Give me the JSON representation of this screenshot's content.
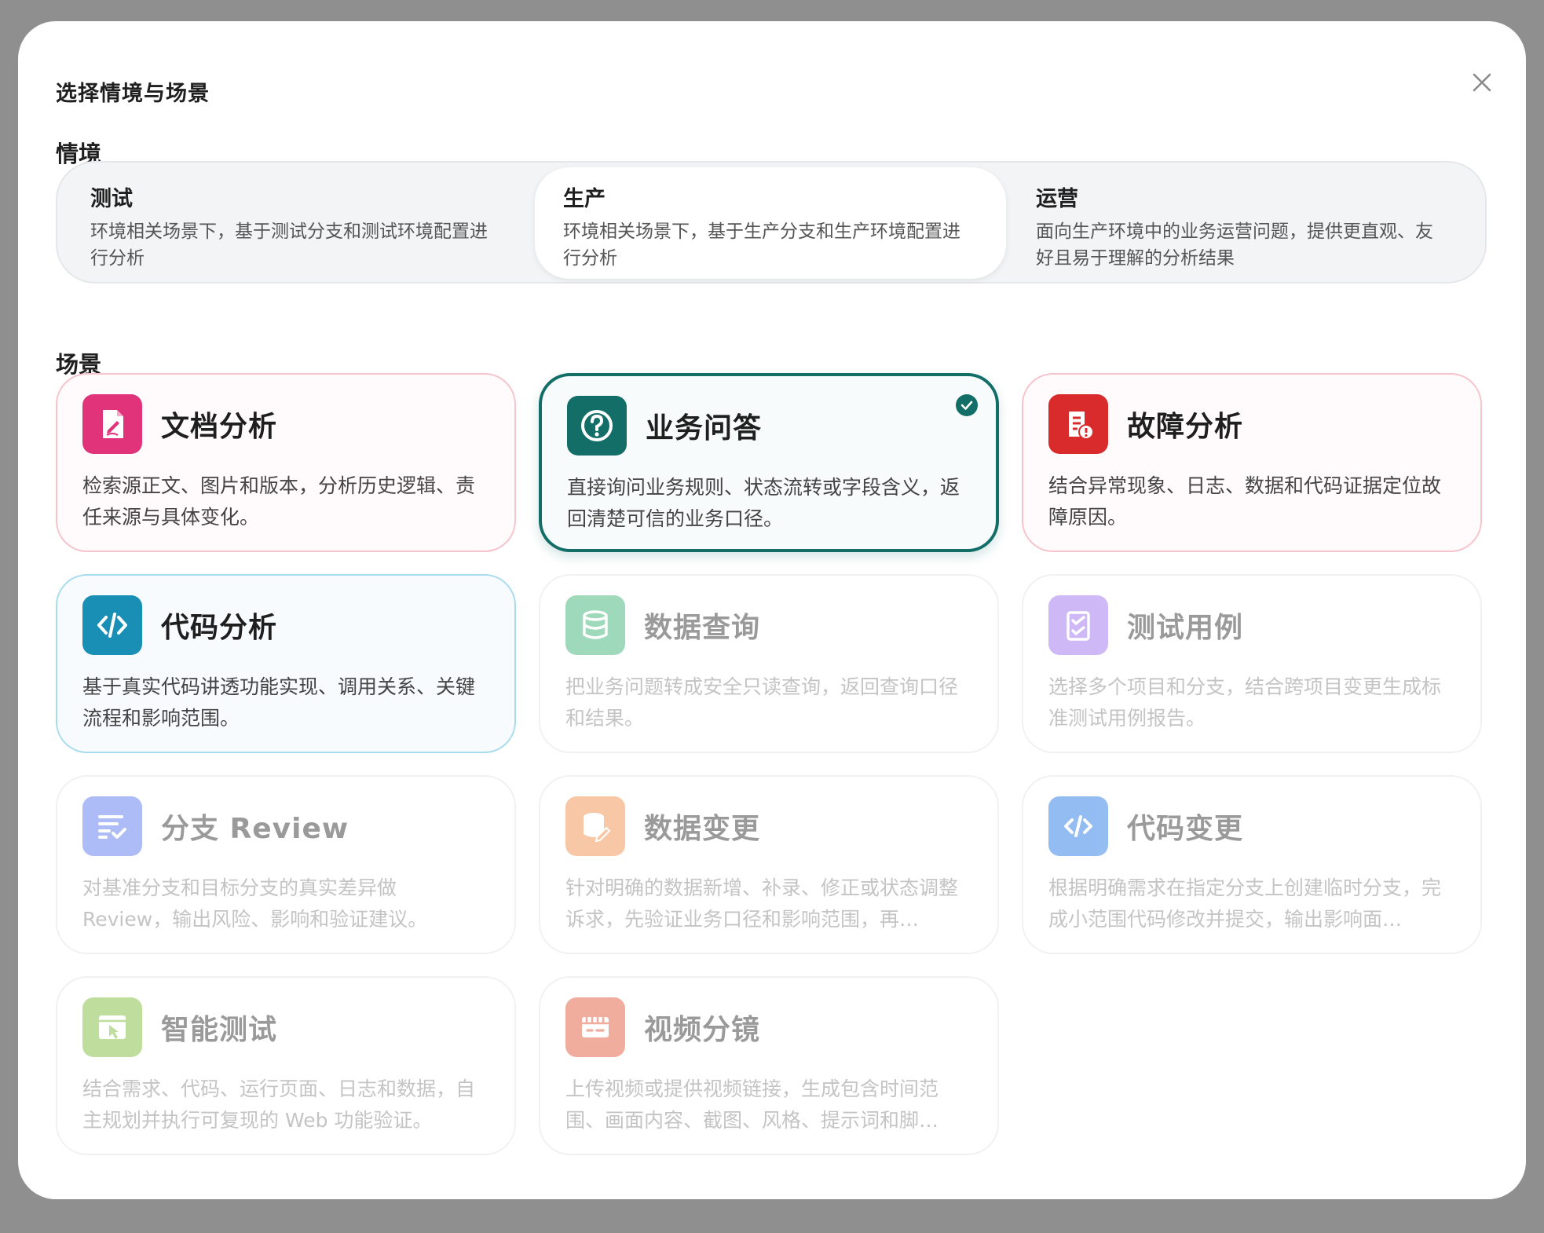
{
  "dialog": {
    "title": "选择情境与场景",
    "close_icon": "close-icon"
  },
  "contexts": {
    "label": "情境",
    "selected": "生产",
    "items": [
      {
        "title": "测试",
        "desc": "环境相关场景下，基于测试分支和测试环境配置进行分析"
      },
      {
        "title": "生产",
        "desc": "环境相关场景下，基于生产分支和生产环境配置进行分析"
      },
      {
        "title": "运营",
        "desc": "面向生产环境中的业务运营问题，提供更直观、友好且易于理解的分析结果"
      }
    ]
  },
  "scenes": {
    "label": "场景",
    "selected": "业务问答",
    "items": [
      {
        "name": "文档分析",
        "desc": "检索源正文、图片和版本，分析历史逻辑、责任来源与具体变化。",
        "icon": "document-edit-icon",
        "color": "#e0337a",
        "state": "enabled"
      },
      {
        "name": "业务问答",
        "desc": "直接询问业务规则、状态流转或字段含义，返回清楚可信的业务口径。",
        "icon": "question-icon",
        "color": "#136e68",
        "state": "selected"
      },
      {
        "name": "故障分析",
        "desc": "结合异常现象、日志、数据和代码证据定位故障原因。",
        "icon": "fault-report-icon",
        "color": "#d92b2b",
        "state": "enabled"
      },
      {
        "name": "代码分析",
        "desc": "基于真实代码讲透功能实现、调用关系、关键流程和影响范围。",
        "icon": "code-icon",
        "color": "#1a8fb5",
        "state": "enabled"
      },
      {
        "name": "数据查询",
        "desc": "把业务问题转成安全只读查询，返回查询口径和结果。",
        "icon": "database-icon",
        "color": "#52bb84",
        "state": "disabled"
      },
      {
        "name": "测试用例",
        "desc": "选择多个项目和分支，结合跨项目变更生成标准测试用例报告。",
        "icon": "checklist-icon",
        "color": "#a87ff0",
        "state": "disabled"
      },
      {
        "name": "分支 Review",
        "desc": "对基准分支和目标分支的真实差异做 Review，输出风险、影响和验证建议。",
        "icon": "review-list-icon",
        "color": "#6b84f0",
        "state": "disabled"
      },
      {
        "name": "数据变更",
        "desc": "针对明确的数据新增、补录、修正或状态调整诉求，先验证业务口径和影响范围，再…",
        "icon": "database-edit-icon",
        "color": "#f39a5c",
        "state": "disabled"
      },
      {
        "name": "代码变更",
        "desc": "根据明确需求在指定分支上创建临时分支，完成小范围代码修改并提交，输出影响面…",
        "icon": "code-change-icon",
        "color": "#3c86e8",
        "state": "disabled"
      },
      {
        "name": "智能测试",
        "desc": "结合需求、代码、运行页面、日志和数据，自主规划并执行可复现的 Web 功能验证。",
        "icon": "browser-cursor-icon",
        "color": "#8cc44e",
        "state": "disabled"
      },
      {
        "name": "视频分镜",
        "desc": "上传视频或提供视频链接，生成包含时间范围、画面内容、截图、风格、提示词和脚…",
        "icon": "storyboard-icon",
        "color": "#e46a4c",
        "state": "disabled"
      }
    ]
  }
}
